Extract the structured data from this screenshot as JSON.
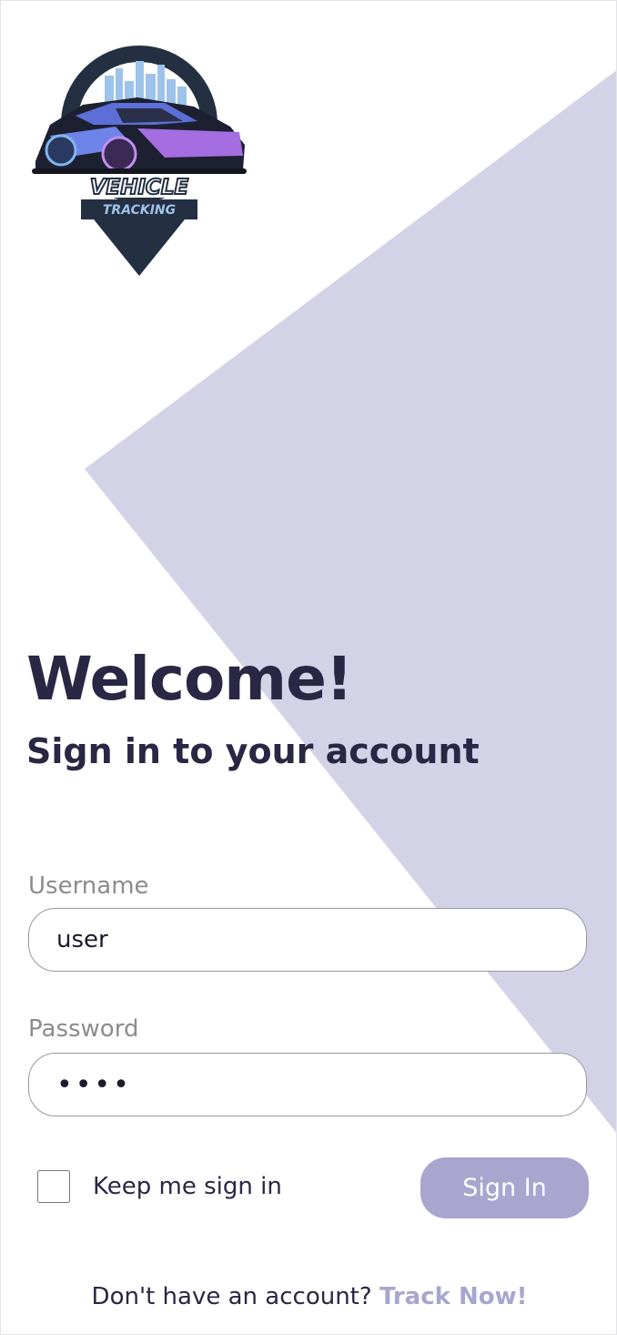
{
  "logo": {
    "line1": "VEHICLE",
    "line2": "TRACKING"
  },
  "heading": {
    "title": "Welcome!",
    "subtitle": "Sign in to your account"
  },
  "form": {
    "username_label": "Username",
    "username_value": "user",
    "password_label": "Password",
    "password_value": "••••",
    "keep_signed_in_label": "Keep me sign in",
    "sign_in_label": "Sign In"
  },
  "footer": {
    "prompt": "Don't have an account?",
    "link_label": "Track Now!"
  },
  "colors": {
    "accent": "#a8a6cf",
    "background_shape": "#d3d2e6",
    "text_dark": "#2a2744",
    "label_gray": "#8f8a8e"
  }
}
